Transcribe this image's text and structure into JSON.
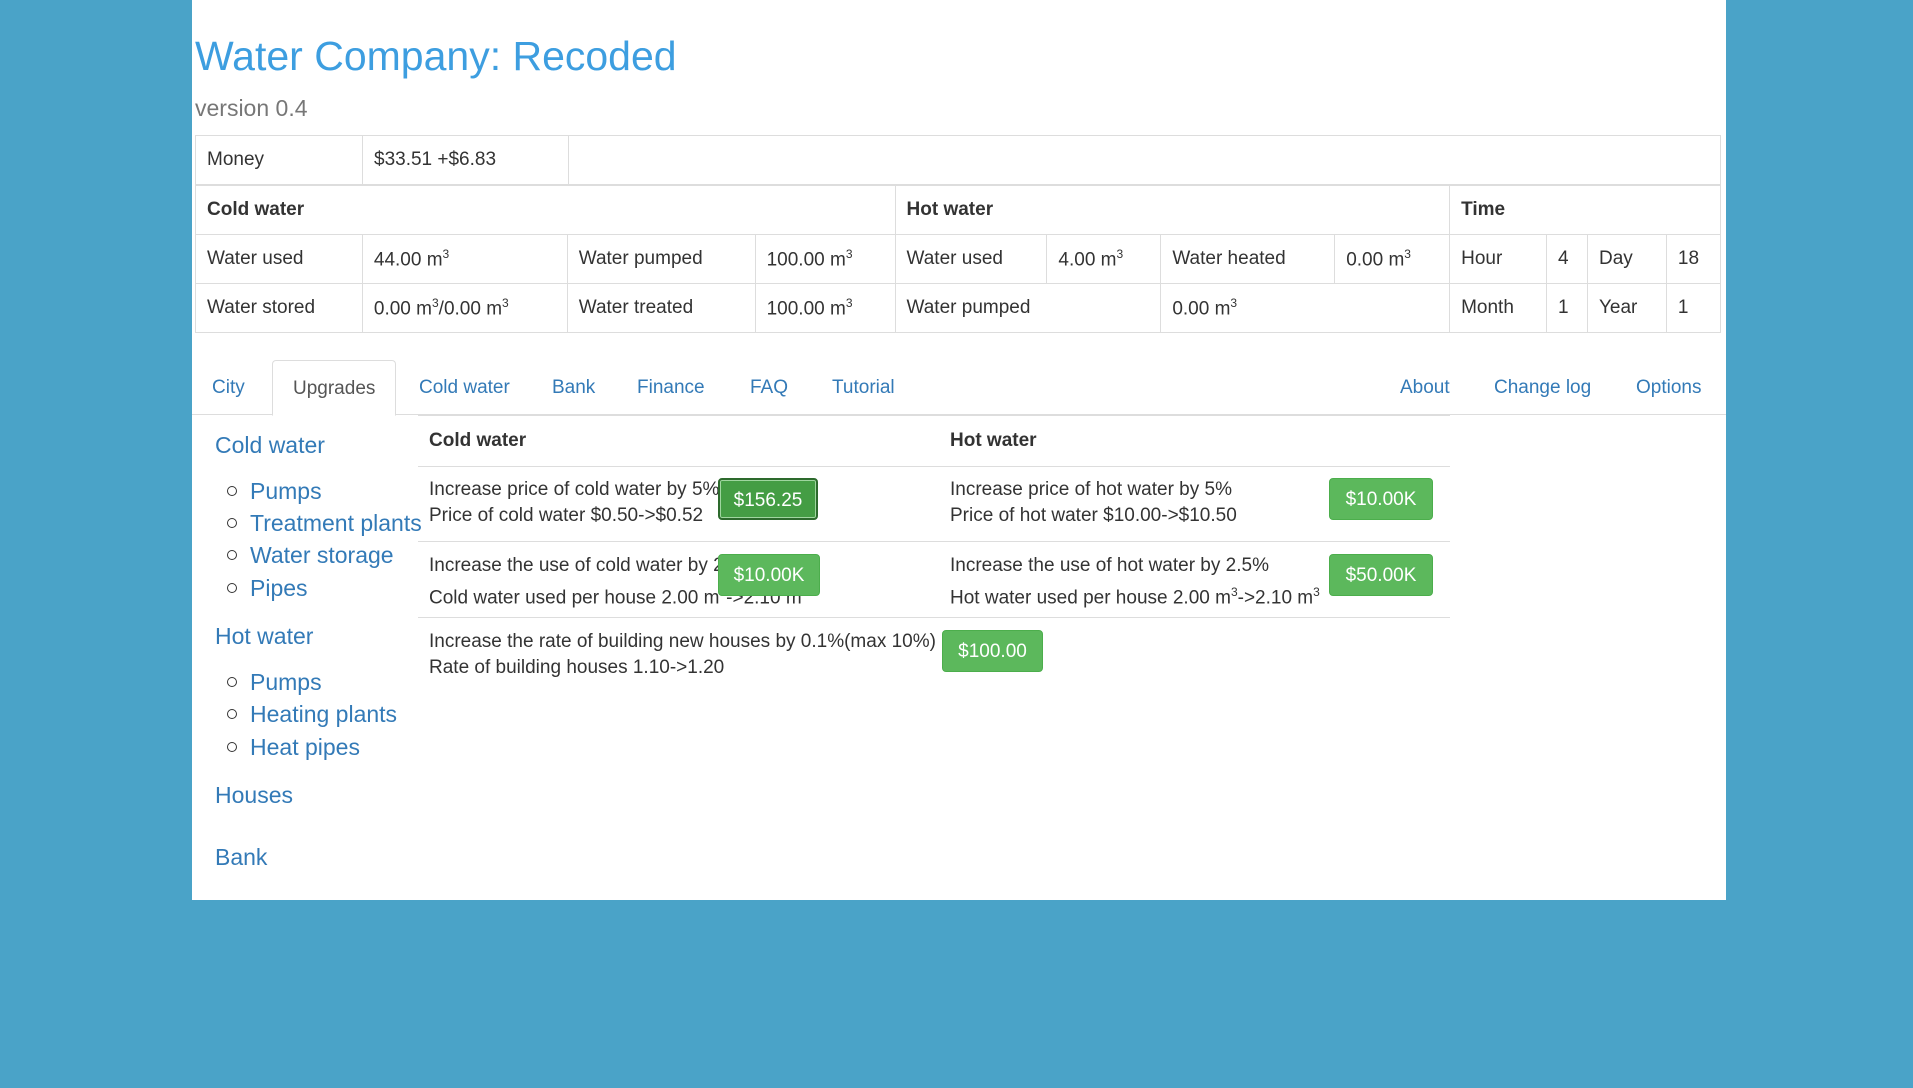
{
  "app": {
    "title": "Water Company: Recoded",
    "version": "version 0.4"
  },
  "money": {
    "label": "Money",
    "value": "$33.51 +$6.83"
  },
  "cold_water": {
    "header": "Cold water",
    "water_used_label": "Water used",
    "water_used_value": "44.00 m",
    "water_pumped_label": "Water pumped",
    "water_pumped_value": "100.00 m",
    "water_stored_label": "Water stored",
    "water_stored_value_a": "0.00 m",
    "water_stored_value_b": "/0.00 m",
    "water_treated_label": "Water treated",
    "water_treated_value": "100.00 m",
    "unit_sup": "3"
  },
  "hot_water": {
    "header": "Hot water",
    "water_used_label": "Water used",
    "water_used_value": "4.00 m",
    "water_heated_label": "Water heated",
    "water_heated_value": "0.00 m",
    "water_pumped_label": "Water pumped",
    "water_pumped_value": "0.00 m",
    "unit_sup": "3"
  },
  "time": {
    "header": "Time",
    "hour_label": "Hour",
    "hour_value": "4",
    "day_label": "Day",
    "day_value": "18",
    "month_label": "Month",
    "month_value": "1",
    "year_label": "Year",
    "year_value": "1"
  },
  "tabs": {
    "left": [
      "City",
      "Upgrades",
      "Cold water",
      "Bank",
      "Finance",
      "FAQ",
      "Tutorial"
    ],
    "right": [
      "About",
      "Change log",
      "Options"
    ],
    "active": "Upgrades"
  },
  "sidebar": {
    "cold_water": "Cold water",
    "cold_items": [
      "Pumps",
      "Treatment plants",
      "Water storage",
      "Pipes"
    ],
    "hot_water": "Hot water",
    "hot_items": [
      "Pumps",
      "Heating plants",
      "Heat pipes"
    ],
    "houses": "Houses",
    "bank": "Bank"
  },
  "upgrades": {
    "col_cold": "Cold water",
    "col_hot": "Hot water",
    "cold_price_line1": "Increase price of cold water by 5%",
    "cold_price_line2": "Price of cold water $0.50->$0.52",
    "cold_price_btn": "$156.25",
    "hot_price_line1": "Increase price of hot water by 5%",
    "hot_price_line2": "Price of hot water $10.00->$10.50",
    "hot_price_btn": "$10.00K",
    "cold_use_line1": "Increase the use of cold water by 2.5%",
    "cold_use_line2a": "Cold water used per house 2.00 m",
    "cold_use_line2b": "->2.10 m",
    "cold_use_btn": "$10.00K",
    "hot_use_line1": "Increase the use of hot water by 2.5%",
    "hot_use_line2a": "Hot water used per house 2.00 m",
    "hot_use_line2b": "->2.10 m",
    "hot_use_btn": "$50.00K",
    "houses_line1": "Increase the rate of building new houses by 0.1%(max 10%)",
    "houses_line2": "Rate of building houses 1.10->1.20",
    "houses_btn": "$100.00",
    "unit_sup": "3"
  },
  "colors": {
    "background": "#4aa3c8",
    "title": "#3d9ee0",
    "link": "#337ab7",
    "button": "#5cb85c"
  }
}
